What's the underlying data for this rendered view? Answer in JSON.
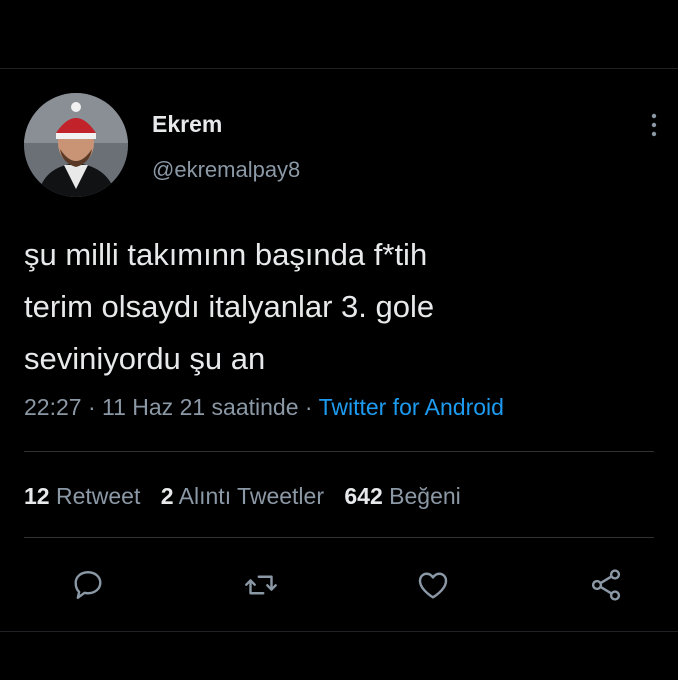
{
  "tweet": {
    "author": {
      "display_name": "Ekrem",
      "handle": "@ekremalpay8"
    },
    "text": "şu milli takımınn başında f*tih\nterim olsaydı italyanlar 3. gole\nseviniyordu şu an",
    "meta": {
      "time": "22:27",
      "date": "11 Haz 21 saatinde",
      "separator": "·",
      "source": "Twitter for Android"
    },
    "stats": {
      "retweets_count": "12",
      "retweets_label": "Retweet",
      "quotes_count": "2",
      "quotes_label": "Alıntı Tweetler",
      "likes_count": "642",
      "likes_label": "Beğeni"
    },
    "actions": {
      "reply_icon": "reply-icon",
      "retweet_icon": "retweet-icon",
      "like_icon": "heart-icon",
      "share_icon": "share-icon"
    }
  },
  "colors": {
    "background": "#000000",
    "text_primary": "#e7e9ea",
    "text_secondary": "#8b98a5",
    "link": "#1d9bf0",
    "divider": "#2f3336"
  }
}
